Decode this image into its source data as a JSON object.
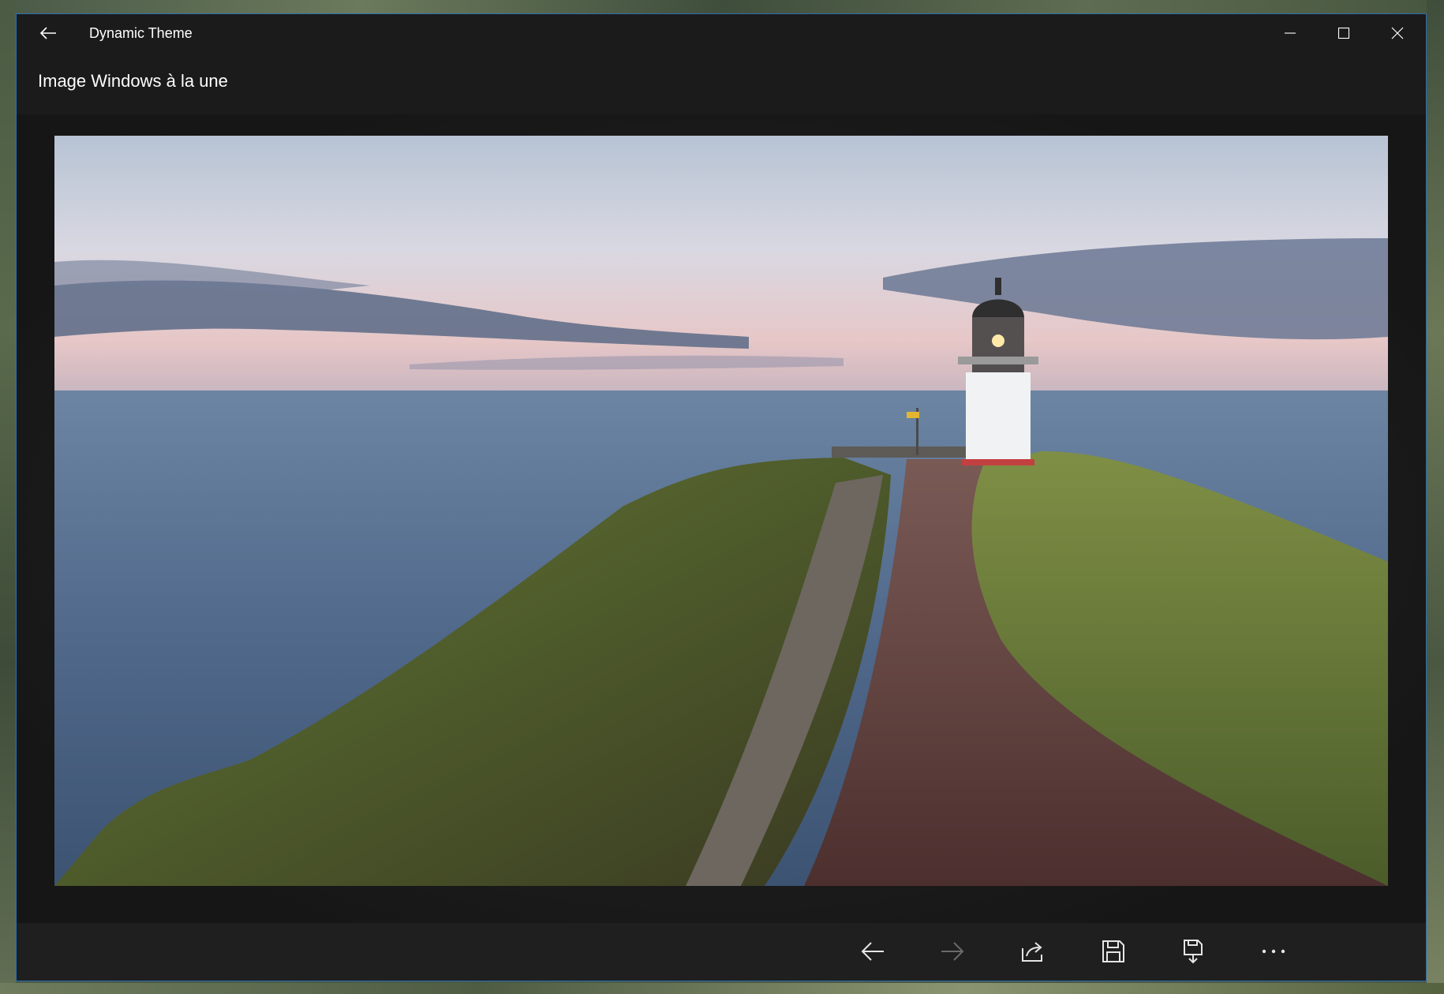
{
  "window": {
    "app_title": "Dynamic Theme",
    "accent_border": "#2d6fb0",
    "controls": {
      "minimize_icon": "minimize-icon",
      "maximize_icon": "maximize-icon",
      "close_icon": "close-icon"
    }
  },
  "nav": {
    "back_icon": "arrow-left-icon"
  },
  "page": {
    "title": "Image Windows à la une"
  },
  "wallpaper": {
    "subject": "lighthouse-on-cliff-photo"
  },
  "appbar": {
    "buttons": [
      {
        "icon": "arrow-left-icon",
        "enabled": true
      },
      {
        "icon": "arrow-right-icon",
        "enabled": false
      },
      {
        "icon": "share-icon",
        "enabled": true
      },
      {
        "icon": "save-icon",
        "enabled": true
      },
      {
        "icon": "save-as-icon",
        "enabled": true
      },
      {
        "icon": "more-icon",
        "enabled": true
      }
    ]
  },
  "colors": {
    "window_bg": "#1b1b1b",
    "appbar_bg": "#1f1f1f",
    "text": "#ffffff",
    "icon": "#e6e6e6",
    "icon_disabled": "#6a6a6a"
  }
}
